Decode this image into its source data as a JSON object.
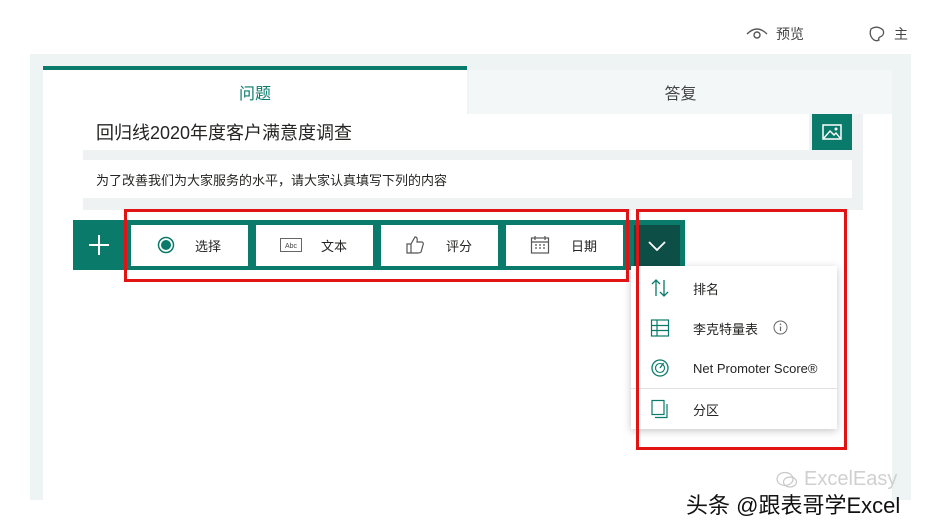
{
  "topbar": {
    "preview_label": "预览",
    "clipped_label": "主"
  },
  "tabs": {
    "questions": "问题",
    "responses": "答复"
  },
  "form": {
    "title": "回归线2020年度客户满意度调查",
    "description": "为了改善我们为大家服务的水平，请大家认真填写下列的内容"
  },
  "question_types": [
    {
      "label": "选择",
      "icon": "radio-icon"
    },
    {
      "label": "文本",
      "icon": "text-abc-icon"
    },
    {
      "label": "评分",
      "icon": "thumbs-up-icon"
    },
    {
      "label": "日期",
      "icon": "calendar-icon"
    }
  ],
  "more_menu": [
    {
      "label": "排名",
      "icon": "sort-arrows-icon"
    },
    {
      "label": "李克特量表",
      "icon": "grid-icon",
      "info_icon": "info-icon"
    },
    {
      "label": "Net Promoter Score®",
      "icon": "gauge-icon"
    },
    {
      "label": "分区",
      "icon": "section-pages-icon"
    }
  ],
  "watermark": {
    "logo_text": "ExcelEasy",
    "text": "头条 @跟表哥学Excel"
  },
  "colors": {
    "accent": "#0a7a6b",
    "accent_dark": "#0d4f47",
    "highlight": "#e01414"
  }
}
